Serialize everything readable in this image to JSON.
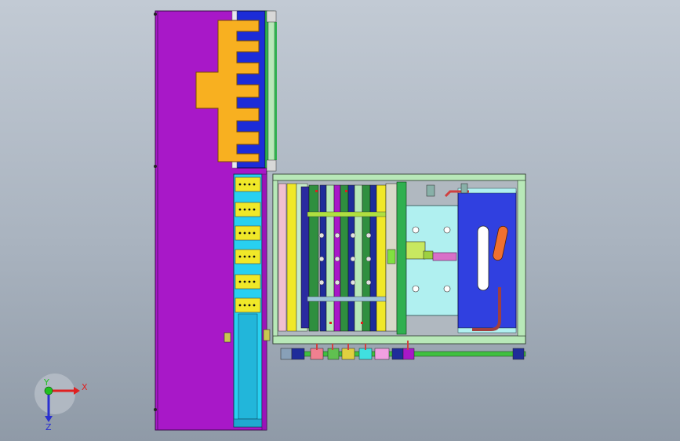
{
  "viewport": {
    "background_top": "#c2cad4",
    "background_bottom": "#8f9aa7"
  },
  "colors": {
    "purple_plate": "#a818c8",
    "orange_insert": "#f8b020",
    "blue_slot": "#1c2cd8",
    "cyan_slider": "#28d0f0",
    "yellow_block": "#f0e828",
    "green_rail": "#30b050",
    "mint_frame": "#b8e8b8",
    "pale_cyan": "#b0f0f0",
    "tank_blue": "#3040e0",
    "pipe_green": "#40c040",
    "red_pipe": "#d04040"
  },
  "triad": {
    "x_label": "X",
    "y_label": "Y",
    "z_label": "Z"
  }
}
